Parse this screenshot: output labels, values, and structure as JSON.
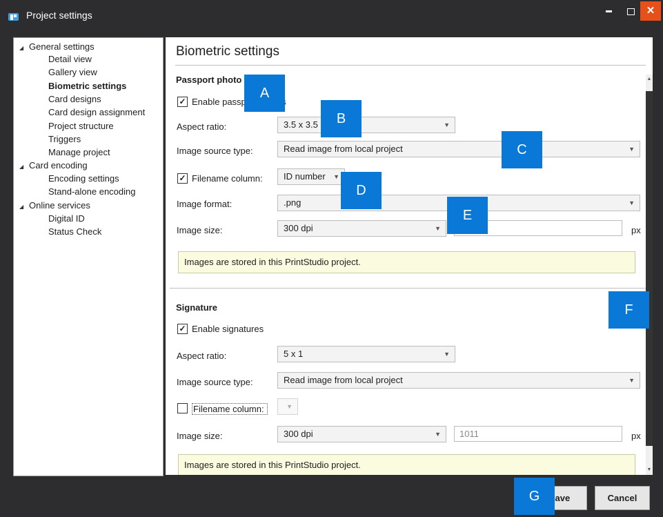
{
  "window": {
    "title": "Project settings",
    "close_glyph": "✕"
  },
  "tree": {
    "groups": [
      {
        "label": "General settings",
        "items": [
          "Detail view",
          "Gallery view",
          "Biometric settings",
          "Card designs",
          "Card design assignment",
          "Project structure",
          "Triggers",
          "Manage project"
        ]
      },
      {
        "label": "Card encoding",
        "items": [
          "Encoding settings",
          "Stand-alone encoding"
        ]
      },
      {
        "label": "Online services",
        "items": [
          "Digital ID",
          "Status Check"
        ]
      }
    ],
    "selected": "Biometric settings"
  },
  "panel": {
    "title": "Biometric settings",
    "passport": {
      "heading": "Passport photo",
      "enable_label": "Enable passport photos",
      "enable_checked": true,
      "aspect_label": "Aspect ratio:",
      "aspect_value": "3.5 x 3.5",
      "source_label": "Image source type:",
      "source_value": "Read image from local project",
      "filename_label": "Filename column:",
      "filename_checked": true,
      "filename_value": "ID number",
      "format_label": "Image format:",
      "format_value": ".png",
      "size_label": "Image size:",
      "size_value": "300 dpi",
      "size_px": "",
      "size_unit": "px",
      "note": "Images are stored in this PrintStudio project."
    },
    "signature": {
      "heading": "Signature",
      "enable_label": "Enable signatures",
      "enable_checked": true,
      "aspect_label": "Aspect ratio:",
      "aspect_value": "5 x 1",
      "source_label": "Image source type:",
      "source_value": "Read image from local project",
      "filename_label": "Filename column:",
      "filename_checked": false,
      "size_label": "Image size:",
      "size_value": "300 dpi",
      "size_px": "1011",
      "size_unit": "px",
      "note": "Images are stored in this PrintStudio project."
    }
  },
  "footer": {
    "save_label": "Save",
    "cancel_label": "Cancel"
  },
  "callouts": [
    "A",
    "B",
    "C",
    "D",
    "E",
    "F",
    "G"
  ],
  "colors": {
    "callout": "#0a78d7",
    "close": "#e8501a",
    "chrome": "#2d2d30",
    "note_bg": "#fbfbe0"
  }
}
